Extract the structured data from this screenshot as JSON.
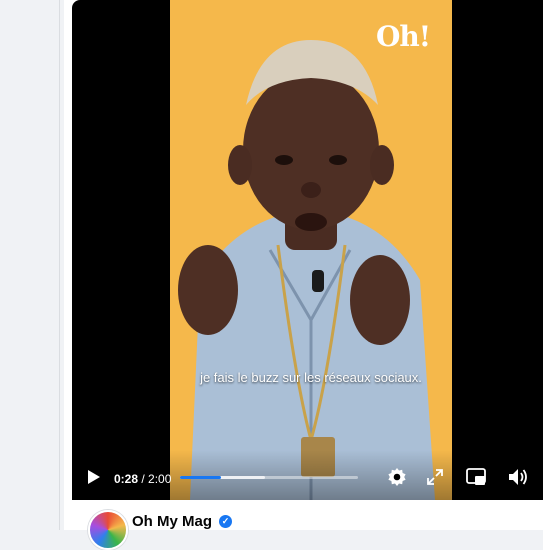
{
  "brand": {
    "logo_text": "Oh!"
  },
  "video": {
    "subtitle": "je fais le buzz sur les réseaux sociaux.",
    "current_time": "0:28",
    "duration": "2:00",
    "progress_fraction": 0.233,
    "buffered_fraction": 0.48
  },
  "post": {
    "page_name": "Oh My Mag"
  },
  "icons": {
    "play": "play-icon",
    "settings": "gear-icon",
    "fullscreen": "expand-icon",
    "pip": "picture-in-picture-icon",
    "volume": "volume-icon",
    "verified": "verified-badge-icon"
  },
  "colors": {
    "accent": "#1877f2",
    "video_bg": "#f5b84b"
  }
}
